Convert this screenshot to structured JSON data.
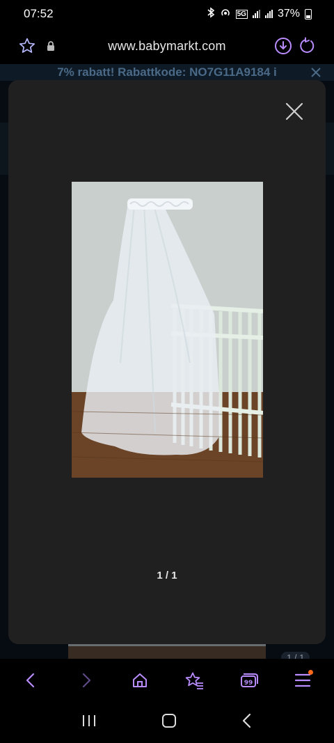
{
  "status": {
    "time": "07:52",
    "battery": "37%",
    "network": "5G"
  },
  "browser": {
    "url": "www.babymarkt.com"
  },
  "promo": {
    "text": "7% rabatt! Rabattkode: NO7G11A9184 i"
  },
  "gallery": {
    "counter": "1 / 1"
  },
  "background_page": {
    "counter": "1 / 1"
  },
  "colors": {
    "accent": "#b98cff",
    "notification": "#ff6a1a",
    "modal": "#202020"
  }
}
